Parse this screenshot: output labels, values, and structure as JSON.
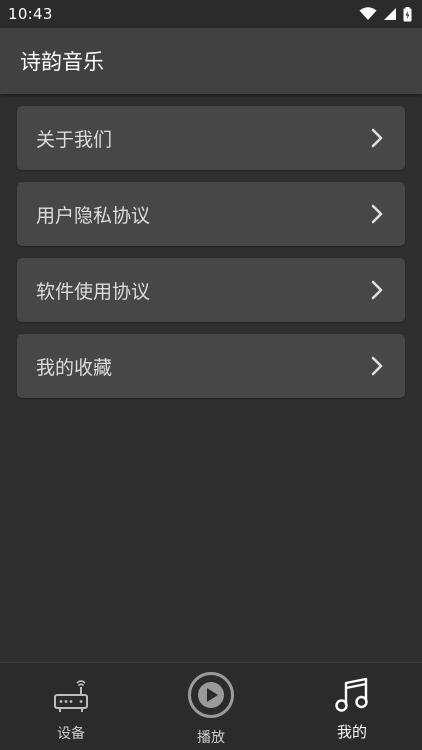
{
  "status_bar": {
    "time": "10:43"
  },
  "app_bar": {
    "title": "诗韵音乐"
  },
  "menu": {
    "items": [
      {
        "label": "关于我们"
      },
      {
        "label": "用户隐私协议"
      },
      {
        "label": "软件使用协议"
      },
      {
        "label": "我的收藏"
      }
    ]
  },
  "bottom_nav": {
    "items": [
      {
        "label": "设备",
        "icon": "router-icon",
        "active": false
      },
      {
        "label": "播放",
        "icon": "play-circle-icon",
        "active": false
      },
      {
        "label": "我的",
        "icon": "music-note-icon",
        "active": true
      }
    ]
  },
  "colors": {
    "background": "#2f2f2f",
    "app_bar": "#414141",
    "card": "#474747",
    "text_primary": "#ffffff",
    "text_secondary": "#cfcfcf"
  }
}
